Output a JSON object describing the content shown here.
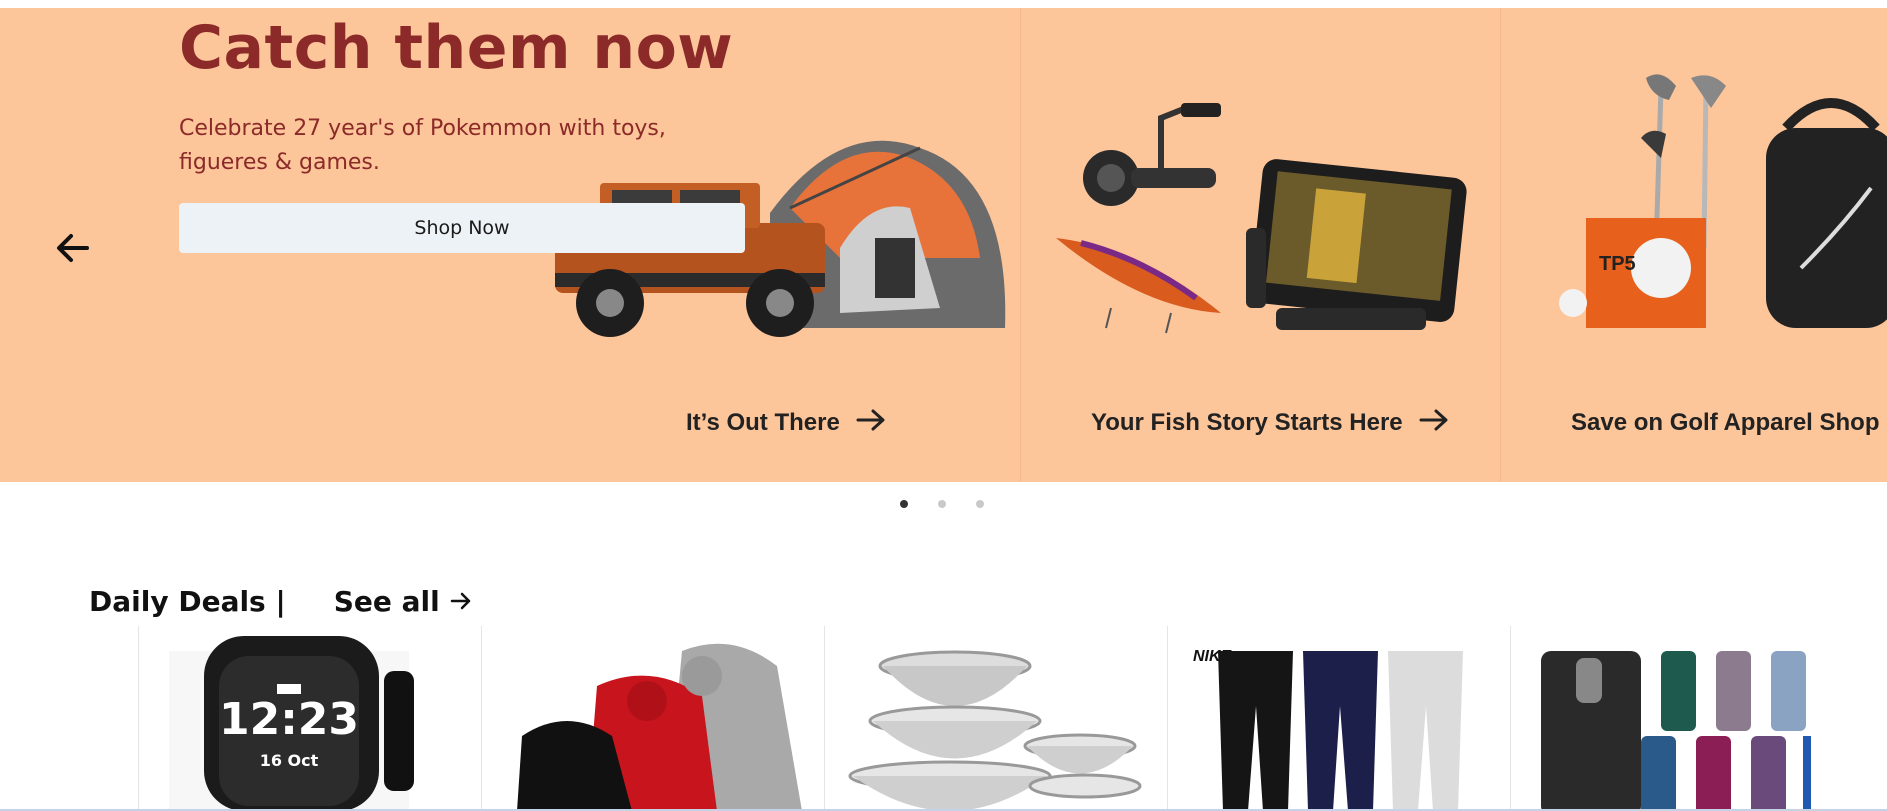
{
  "hero": {
    "title": "Catch them now",
    "subtitle": "Celebrate 27 year's of Pokemmon with toys, figueres & games.",
    "button_label": "Shop Now",
    "prev_icon": "arrow-left-icon",
    "background_color": "#fdc59a",
    "title_color": "#8b2a28",
    "promos": [
      {
        "caption": "It’s Out There",
        "icon": "arrow-right-icon",
        "art": "jeep-tent-image"
      },
      {
        "caption": "Your Fish Story Starts Here",
        "icon": "arrow-right-icon",
        "art": "fishing-gear-image"
      },
      {
        "caption": "Save on Golf Apparel Shop",
        "icon": "arrow-right-icon",
        "art": "golf-gear-image"
      }
    ]
  },
  "carousel": {
    "dots": 3,
    "active_index": 0
  },
  "deals": {
    "title": "Daily Deals |",
    "see_all_label": "See all",
    "see_all_icon": "arrow-right-icon",
    "items": [
      {
        "name": "smartwatch",
        "watch_time": "12:23",
        "watch_date": "16 Oct"
      },
      {
        "name": "hoodies",
        "brand": ""
      },
      {
        "name": "mixing-bowls"
      },
      {
        "name": "joggers",
        "brand": "NIKE"
      },
      {
        "name": "travel-mugs"
      }
    ]
  }
}
